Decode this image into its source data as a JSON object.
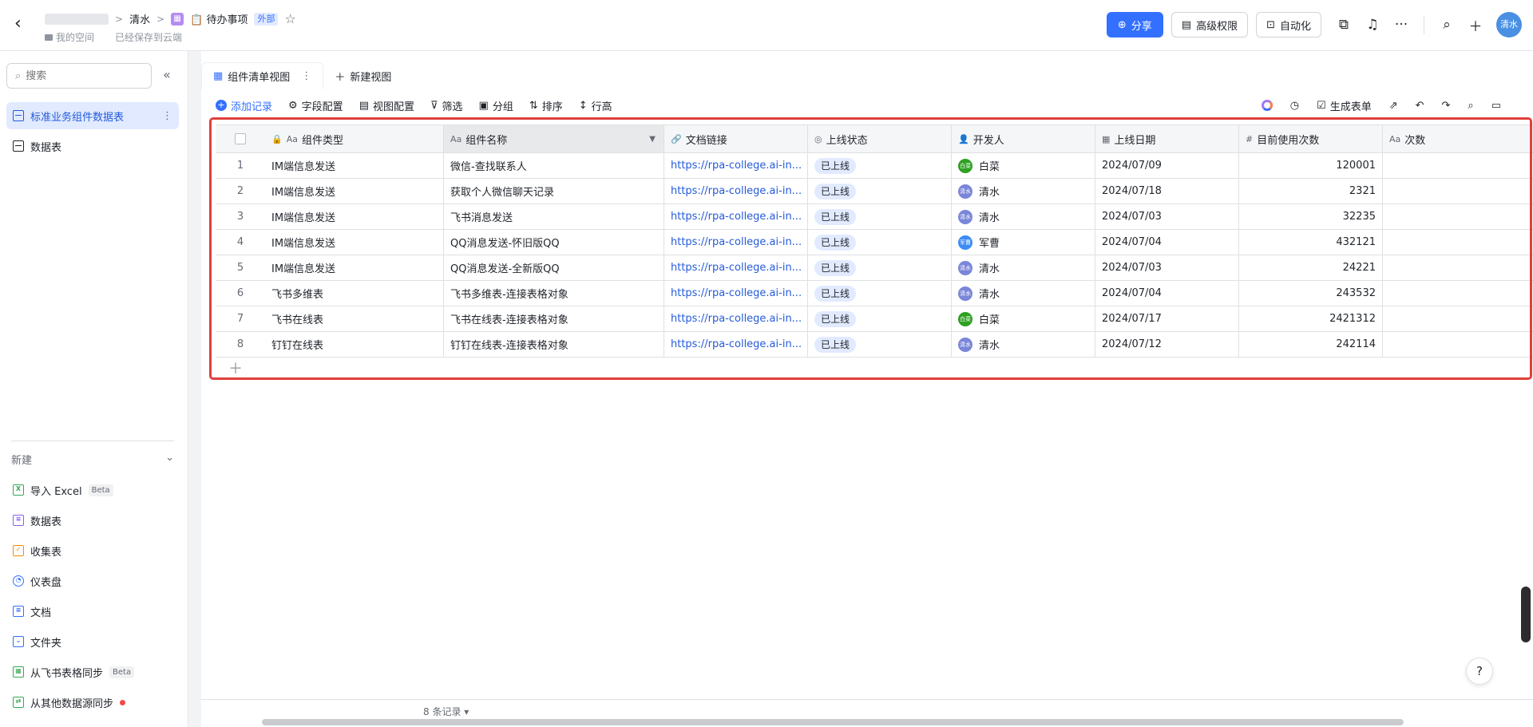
{
  "topbar": {
    "back_icon": "chevron-left-icon",
    "crumbs": {
      "owner": "清水",
      "doc_title": "📋 待办事项",
      "ext_tag": "外部"
    },
    "sub": {
      "space": "我的空间",
      "saved": "已经保存到云端"
    },
    "share_label": "分享",
    "perm_label": "高级权限",
    "auto_label": "自动化",
    "avatar_text": "清水"
  },
  "sidebar": {
    "search_placeholder": "搜索",
    "tables": [
      {
        "label": "标准业务组件数据表",
        "active": true
      },
      {
        "label": "数据表",
        "active": false
      }
    ],
    "new_label": "新建",
    "new_items": [
      {
        "label": "导入 Excel",
        "beta": "Beta",
        "color": "#34a853"
      },
      {
        "label": "数据表",
        "beta": "",
        "color": "#8b5cf6"
      },
      {
        "label": "收集表",
        "beta": "",
        "color": "#ff8800"
      },
      {
        "label": "仪表盘",
        "beta": "",
        "color": "#3370ff"
      },
      {
        "label": "文档",
        "beta": "",
        "color": "#3370ff"
      },
      {
        "label": "文件夹",
        "beta": "",
        "color": "#3370ff"
      },
      {
        "label": "从飞书表格同步",
        "beta": "Beta",
        "color": "#34a853"
      },
      {
        "label": "从其他数据源同步",
        "beta": "",
        "color": "#34a853"
      }
    ]
  },
  "view": {
    "tabs": [
      {
        "label": "组件清单视图"
      },
      {
        "label": "新建视图"
      }
    ],
    "toolbar": {
      "add_record": "添加记录",
      "field_config": "字段配置",
      "view_config": "视图配置",
      "filter": "筛选",
      "group": "分组",
      "sort": "排序",
      "row_height": "行高",
      "gen_form": "生成表单"
    }
  },
  "table": {
    "columns": [
      {
        "label": "组件类型",
        "icon": "text-icon"
      },
      {
        "label": "组件名称",
        "icon": "text-icon"
      },
      {
        "label": "文档链接",
        "icon": "link-icon"
      },
      {
        "label": "上线状态",
        "icon": "status-icon"
      },
      {
        "label": "开发人",
        "icon": "person-icon"
      },
      {
        "label": "上线日期",
        "icon": "calendar-icon"
      },
      {
        "label": "目前使用次数",
        "icon": "number-icon"
      },
      {
        "label": "次数",
        "icon": "text-icon"
      }
    ],
    "rows": [
      {
        "n": "1",
        "type": "IM端信息发送",
        "name": "微信-查找联系人",
        "link": "https://rpa-college.ai-in...",
        "status": "已上线",
        "dev": "白菜",
        "dev_av": "白菜",
        "dev_color": "#2ea121",
        "date": "2024/07/09",
        "count": "120001"
      },
      {
        "n": "2",
        "type": "IM端信息发送",
        "name": "获取个人微信聊天记录",
        "link": "https://rpa-college.ai-in...",
        "status": "已上线",
        "dev": "清水",
        "dev_av": "清水",
        "dev_color": "#7a86d9",
        "date": "2024/07/18",
        "count": "2321"
      },
      {
        "n": "3",
        "type": "IM端信息发送",
        "name": "飞书消息发送",
        "link": "https://rpa-college.ai-in...",
        "status": "已上线",
        "dev": "清水",
        "dev_av": "清水",
        "dev_color": "#7a86d9",
        "date": "2024/07/03",
        "count": "32235"
      },
      {
        "n": "4",
        "type": "IM端信息发送",
        "name": "QQ消息发送-怀旧版QQ",
        "link": "https://rpa-college.ai-in...",
        "status": "已上线",
        "dev": "军曹",
        "dev_av": "军曹",
        "dev_color": "#3b8cf5",
        "date": "2024/07/04",
        "count": "432121"
      },
      {
        "n": "5",
        "type": "IM端信息发送",
        "name": "QQ消息发送-全新版QQ",
        "link": "https://rpa-college.ai-in...",
        "status": "已上线",
        "dev": "清水",
        "dev_av": "清水",
        "dev_color": "#7a86d9",
        "date": "2024/07/03",
        "count": "24221"
      },
      {
        "n": "6",
        "type": "飞书多维表",
        "name": "飞书多维表-连接表格对象",
        "link": "https://rpa-college.ai-in...",
        "status": "已上线",
        "dev": "清水",
        "dev_av": "清水",
        "dev_color": "#7a86d9",
        "date": "2024/07/04",
        "count": "243532"
      },
      {
        "n": "7",
        "type": "飞书在线表",
        "name": "飞书在线表-连接表格对象",
        "link": "https://rpa-college.ai-in...",
        "status": "已上线",
        "dev": "白菜",
        "dev_av": "白菜",
        "dev_color": "#2ea121",
        "date": "2024/07/17",
        "count": "2421312"
      },
      {
        "n": "8",
        "type": "钉钉在线表",
        "name": "钉钉在线表-连接表格对象",
        "link": "https://rpa-college.ai-in...",
        "status": "已上线",
        "dev": "清水",
        "dev_av": "清水",
        "dev_color": "#7a86d9",
        "date": "2024/07/12",
        "count": "242114"
      }
    ]
  },
  "footer": {
    "count": "8 条记录"
  },
  "colors": {
    "accent": "#3370ff",
    "highlight": "#e0403d"
  }
}
